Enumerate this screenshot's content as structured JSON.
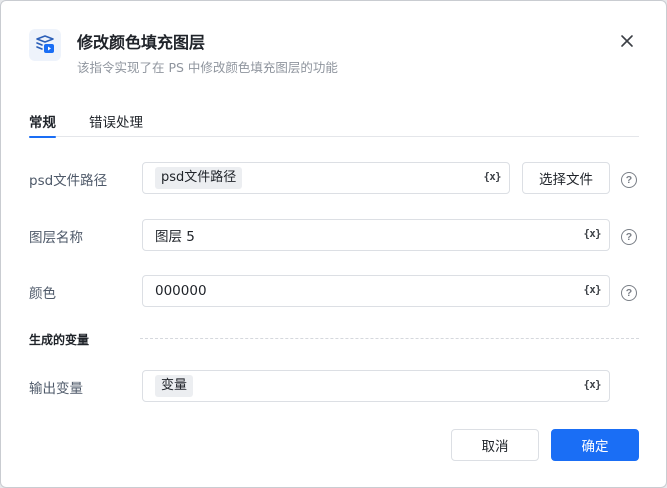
{
  "dialog": {
    "title": "修改颜色填充图层",
    "subtitle": "该指令实现了在 PS 中修改颜色填充图层的功能",
    "icon": "ps-layer-icon",
    "accent_color": "#1a6ef5"
  },
  "tabs": [
    {
      "label": "常规",
      "active": true
    },
    {
      "label": "错误处理",
      "active": false
    }
  ],
  "fields": {
    "psd_path": {
      "label": "psd文件路径",
      "value": "psd文件路径",
      "var_icon": "{x}"
    },
    "layer_name": {
      "label": "图层名称",
      "value": "图层 5",
      "var_icon": "{x}"
    },
    "color": {
      "label": "颜色",
      "value": "000000",
      "var_icon": "{x}"
    }
  },
  "select_file_label": "选择文件",
  "help_glyph": "?",
  "output_section": {
    "title": "生成的变量",
    "output_var": {
      "label": "输出变量",
      "value": "变量",
      "var_icon": "{x}"
    }
  },
  "footer": {
    "cancel_label": "取消",
    "confirm_label": "确定"
  }
}
